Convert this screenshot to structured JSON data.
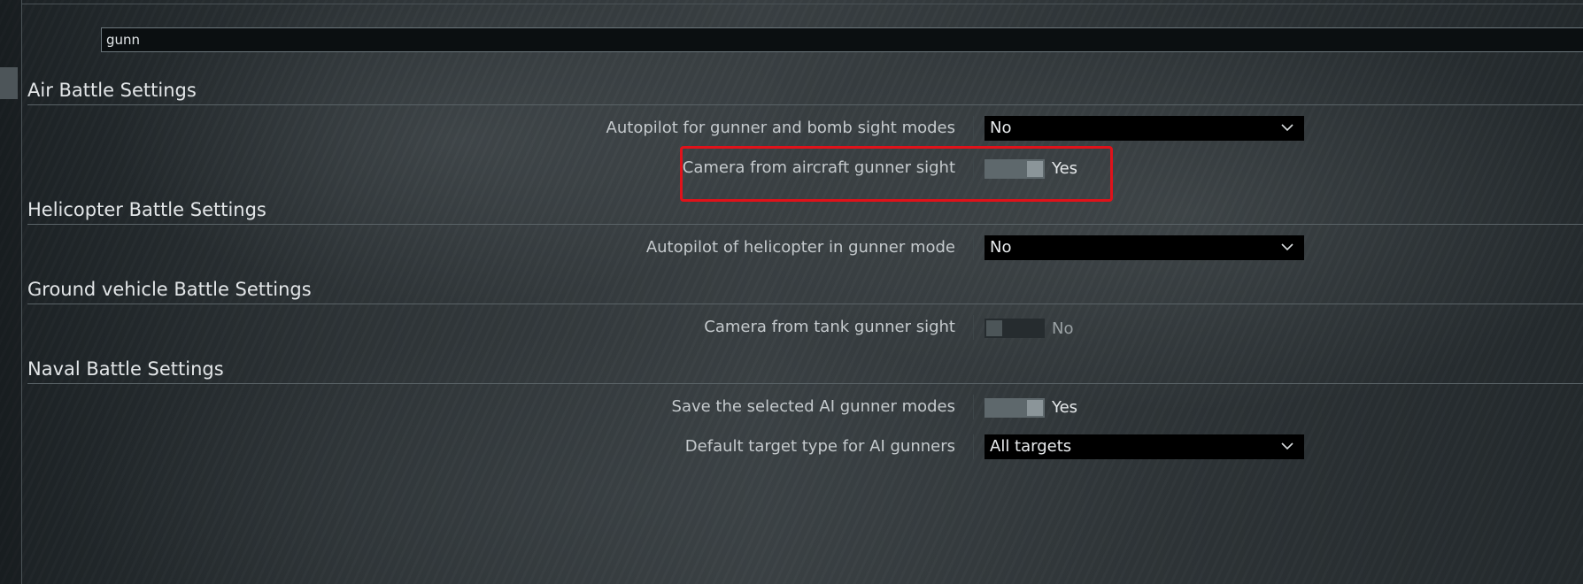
{
  "search": {
    "value": "gunn"
  },
  "sections": {
    "air": {
      "title": "Air Battle Settings",
      "rows": {
        "autopilot": {
          "label": "Autopilot for gunner and bomb sight modes",
          "value": "No"
        },
        "camera": {
          "label": "Camera from aircraft gunner sight",
          "value": "Yes",
          "toggle_on": true
        }
      }
    },
    "helicopter": {
      "title": "Helicopter Battle Settings",
      "rows": {
        "autopilot": {
          "label": "Autopilot of helicopter in gunner mode",
          "value": "No"
        }
      }
    },
    "ground": {
      "title": "Ground vehicle Battle Settings",
      "rows": {
        "camera": {
          "label": "Camera from tank gunner sight",
          "value": "No",
          "toggle_on": false
        }
      }
    },
    "naval": {
      "title": "Naval Battle Settings",
      "rows": {
        "save_modes": {
          "label": "Save the selected AI gunner modes",
          "value": "Yes",
          "toggle_on": true
        },
        "target_type": {
          "label": "Default target type for AI gunners",
          "value": "All targets"
        }
      }
    }
  },
  "icons": {
    "dropdown": "chevron-down-icon"
  },
  "colors": {
    "highlight": "#e0121a",
    "dropdown_bg": "#000000",
    "toggle_on": "#5e686c",
    "toggle_off": "#262c2f"
  }
}
